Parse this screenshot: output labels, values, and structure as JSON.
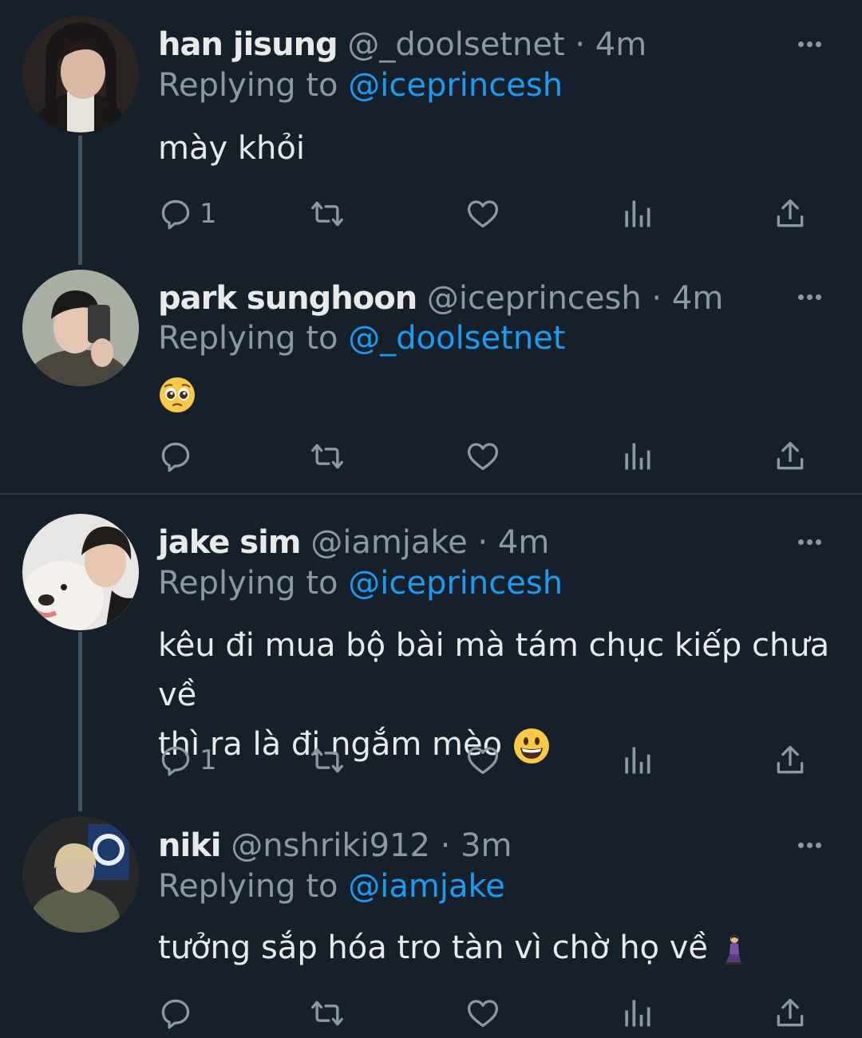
{
  "tweets": [
    {
      "name": "han jisung",
      "handle": "@_doolsetnet",
      "sep": " · ",
      "time": "4m",
      "reply_prefix": "Replying to ",
      "reply_to": "@iceprincesh",
      "text": "mày khỏi",
      "reply_count": "1",
      "avatar_color": "#3a2e2c"
    },
    {
      "name": "park sunghoon",
      "handle": "@iceprincesh",
      "sep": " · ",
      "time": "4m",
      "reply_prefix": "Replying to ",
      "reply_to": "@_doolsetnet",
      "text": "",
      "emoji": "pleading-face",
      "reply_count": "",
      "avatar_color": "#8a8f86"
    },
    {
      "name": "jake sim",
      "handle": "@iamjake",
      "sep": " · ",
      "time": "4m",
      "reply_prefix": "Replying to ",
      "reply_to": "@iceprincesh",
      "text_line1": "kêu đi mua bộ bài mà tám chục kiếp chưa về",
      "text_line2": "thì ra là đi ngắm mèo",
      "emoji": "grinning-face",
      "reply_count": "1",
      "avatar_color": "#cfcfcf"
    },
    {
      "name": "niki",
      "handle": "@nshriki912",
      "sep": " · ",
      "time": "3m",
      "reply_prefix": "Replying to ",
      "reply_to": "@iamjake",
      "text": "tưởng sắp hóa tro tàn vì chờ họ về",
      "emoji": "kneeling-person",
      "reply_count": "",
      "avatar_color": "#2a2f2a"
    }
  ],
  "icons": [
    "reply-icon",
    "retweet-icon",
    "like-icon",
    "views-icon",
    "share-icon",
    "more-icon"
  ],
  "colors": {
    "background": "#15202b",
    "text": "#e7e9ea",
    "secondary": "#8b98a5",
    "link": "#1d9bf0",
    "thread_line": "#3d5466"
  }
}
